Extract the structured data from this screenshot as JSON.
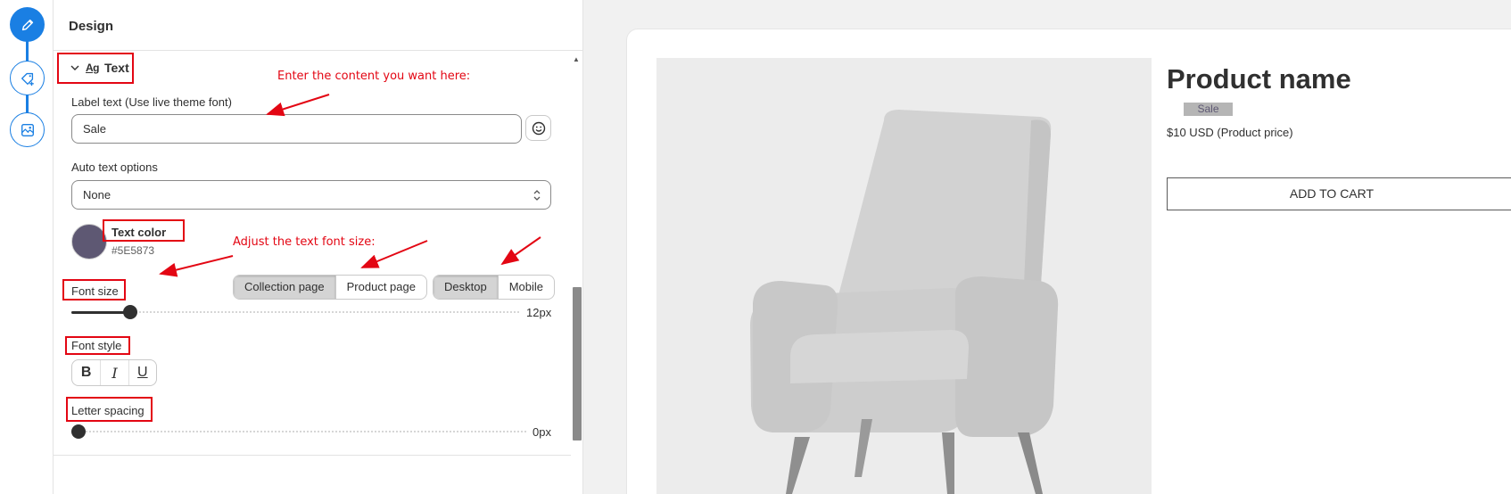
{
  "rail": {
    "steps": [
      {
        "icon": "pencil-icon",
        "state": "active"
      },
      {
        "icon": "tag-add-icon",
        "state": "idle"
      },
      {
        "icon": "image-settings-icon",
        "state": "idle"
      }
    ],
    "accent": "#1a7fe3"
  },
  "panel": {
    "title": "Design",
    "section": {
      "title": "Text",
      "icon": "text-format-icon",
      "icon_text": "Ag"
    },
    "label_text": {
      "label": "Label text (Use live theme font)",
      "value": "Sale"
    },
    "auto_text": {
      "label": "Auto text options",
      "value": "None"
    },
    "text_color": {
      "label": "Text color",
      "hex": "#5E5873",
      "swatch": "#5e5873"
    },
    "font_size": {
      "label": "Font size",
      "page_tabs": [
        "Collection page",
        "Product page"
      ],
      "page_selected": "Collection page",
      "device_tabs": [
        "Desktop",
        "Mobile"
      ],
      "device_selected": "Desktop",
      "value_label": "12px",
      "fraction": 0.13
    },
    "font_style": {
      "label": "Font style",
      "buttons": [
        "B",
        "I",
        "U"
      ]
    },
    "letter_spacing": {
      "label": "Letter spacing",
      "value_label": "0px",
      "fraction": 0
    }
  },
  "annotations": {
    "content_note": "Enter the content you want here:",
    "font_size_note": "Adjust the text font size:",
    "color": "#e30613"
  },
  "preview": {
    "product_name": "Product name",
    "badge": "Sale",
    "price": "$10 USD (Product price)",
    "cta": "ADD TO CART"
  }
}
